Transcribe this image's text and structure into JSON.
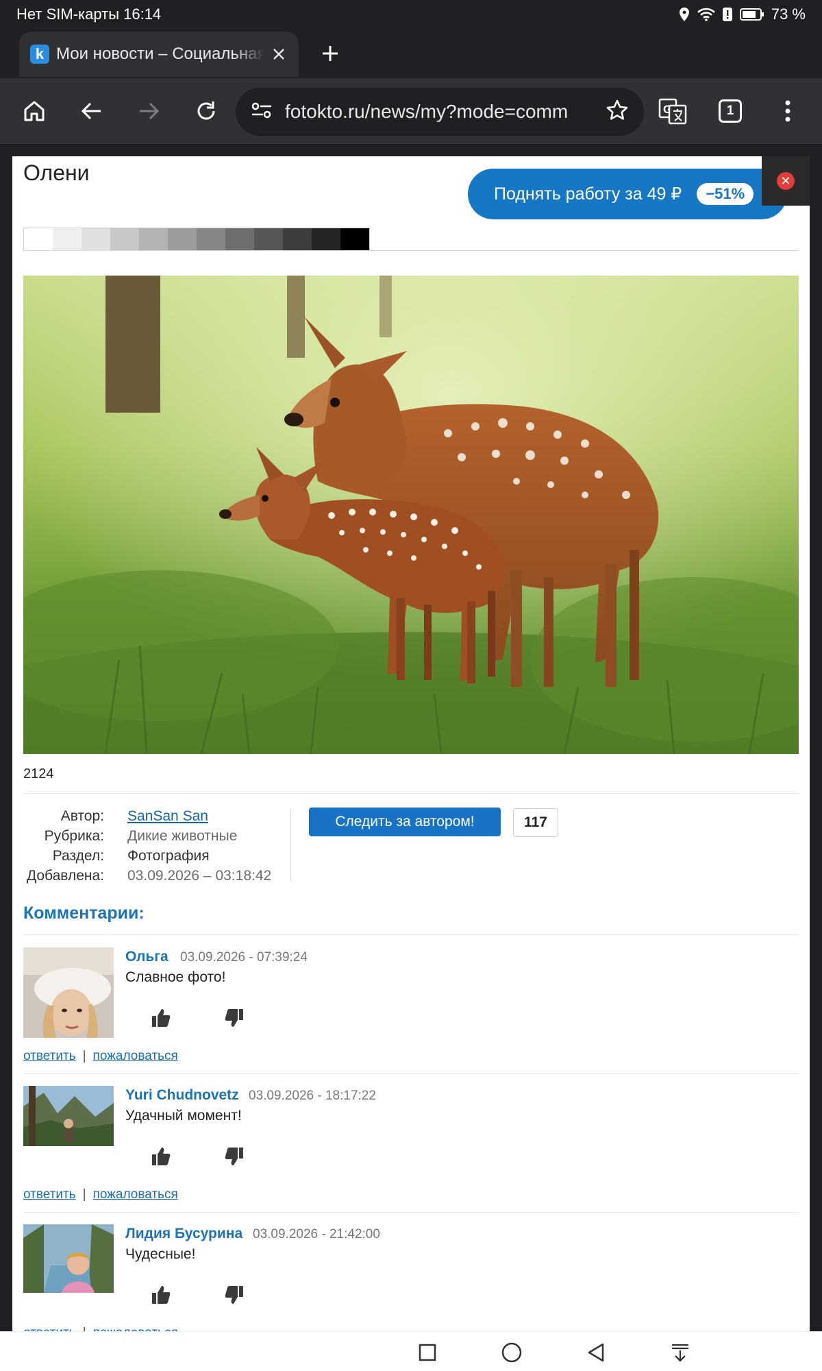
{
  "status": {
    "carrier": "Нет SIM-карты 16:14",
    "battery": "73 %"
  },
  "tab": {
    "favicon_letter": "k",
    "title": "Мои новости – Социальная"
  },
  "omnibox": {
    "url": "fotokto.ru/news/my?mode=comm",
    "tab_count": "1"
  },
  "photo": {
    "title": "Олени",
    "number": "2124"
  },
  "promo": {
    "label": "Поднять работу за 49 ₽",
    "discount": "−51%"
  },
  "swatches": [
    "#ffffff",
    "#f0f0f0",
    "#e0e0e0",
    "#c8c8c8",
    "#b3b3b3",
    "#9c9c9c",
    "#868686",
    "#6e6e6e",
    "#575757",
    "#3d3d3d",
    "#252525",
    "#000000"
  ],
  "meta": {
    "author_label": "Автор:",
    "author_value": "SanSan San",
    "rubric_label": "Рубрика:",
    "rubric_value": "Дикие животные",
    "section_label": "Раздел:",
    "section_value": "Фотография",
    "added_label": "Добавлена:",
    "added_value": "03.09.2026 – 03:18:42"
  },
  "follow": {
    "label": "Следить за автором!",
    "count": "117"
  },
  "comments": {
    "title": "Комментарии:",
    "reply_label": "ответить",
    "complain_label": "пожаловаться",
    "items": [
      {
        "name": "Ольга",
        "date": "03.09.2026 - 07:39:24",
        "text": "Славное фото!"
      },
      {
        "name": "Yuri Chudnovetz",
        "date": "03.09.2026 - 18:17:22",
        "text": "Удачный момент!"
      },
      {
        "name": "Лидия Бусурина",
        "date": "03.09.2026 - 21:42:00",
        "text": "Чудесные!"
      }
    ]
  },
  "colors": {
    "brand_blue": "#1677c5",
    "link_blue": "#1c73b8",
    "browser_dark": "#1f2023",
    "toolbar": "#303135"
  }
}
